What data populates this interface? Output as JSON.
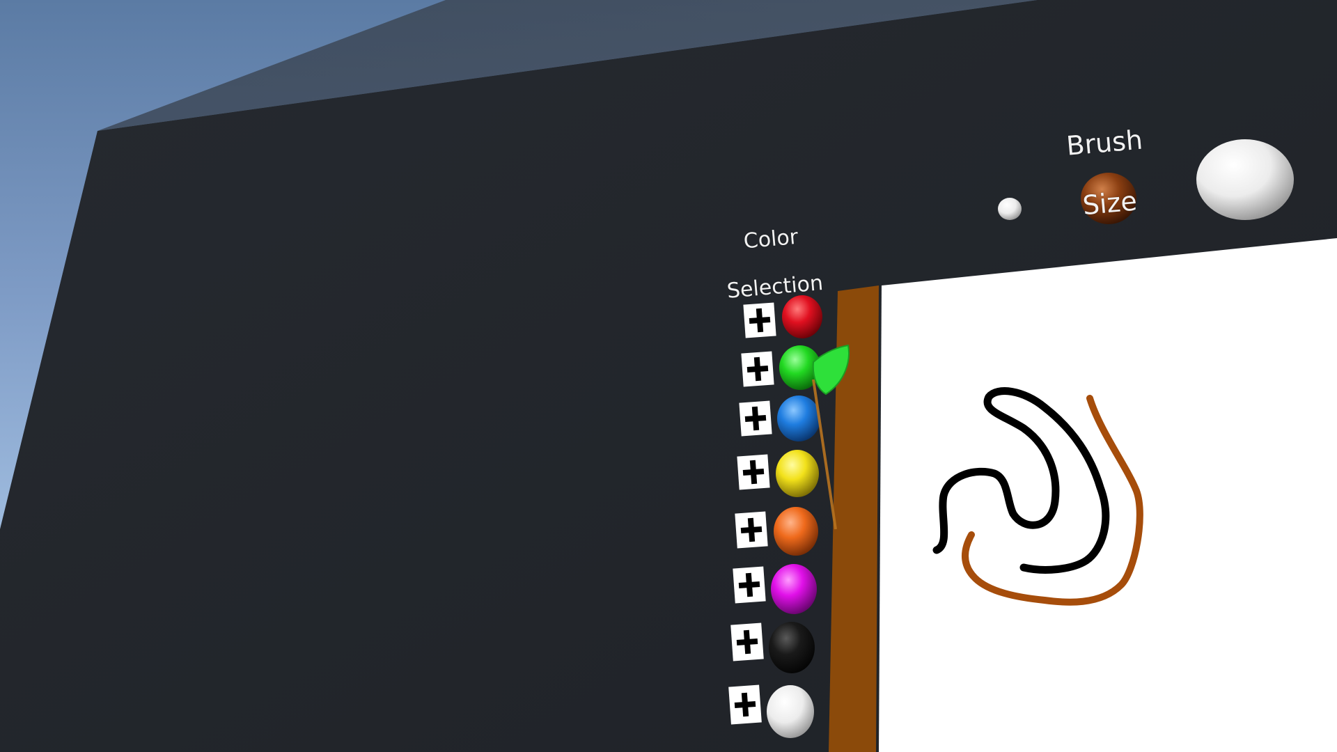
{
  "scene": {
    "sky_color_top": "#5b7ba4",
    "sky_color_bottom": "#c9def2",
    "wall_color": "#23262b",
    "easel_color": "#8b4a0a",
    "canvas_color": "#ffffff"
  },
  "color_selection": {
    "title_line1": "Color",
    "title_line2": "Selection",
    "swatches": [
      {
        "name": "red",
        "color": "#e01020"
      },
      {
        "name": "green",
        "color": "#22d922"
      },
      {
        "name": "blue",
        "color": "#1f7de0"
      },
      {
        "name": "yellow",
        "color": "#f2e11a"
      },
      {
        "name": "orange",
        "color": "#ef6a1c"
      },
      {
        "name": "magenta",
        "color": "#e010e8"
      },
      {
        "name": "black",
        "color": "#111111"
      },
      {
        "name": "white",
        "color": "#f2f2f2"
      }
    ]
  },
  "brush_size": {
    "title_line1": "Brush",
    "title_line2": "Size",
    "options": [
      "small",
      "medium",
      "large"
    ],
    "selected": "medium",
    "selected_color": "#8b3f12"
  },
  "drawing": {
    "stroke_colors": [
      "#000000",
      "#a64d0b"
    ]
  },
  "cursor": {
    "color": "#2ee03a",
    "ray_color": "#b8731f"
  }
}
